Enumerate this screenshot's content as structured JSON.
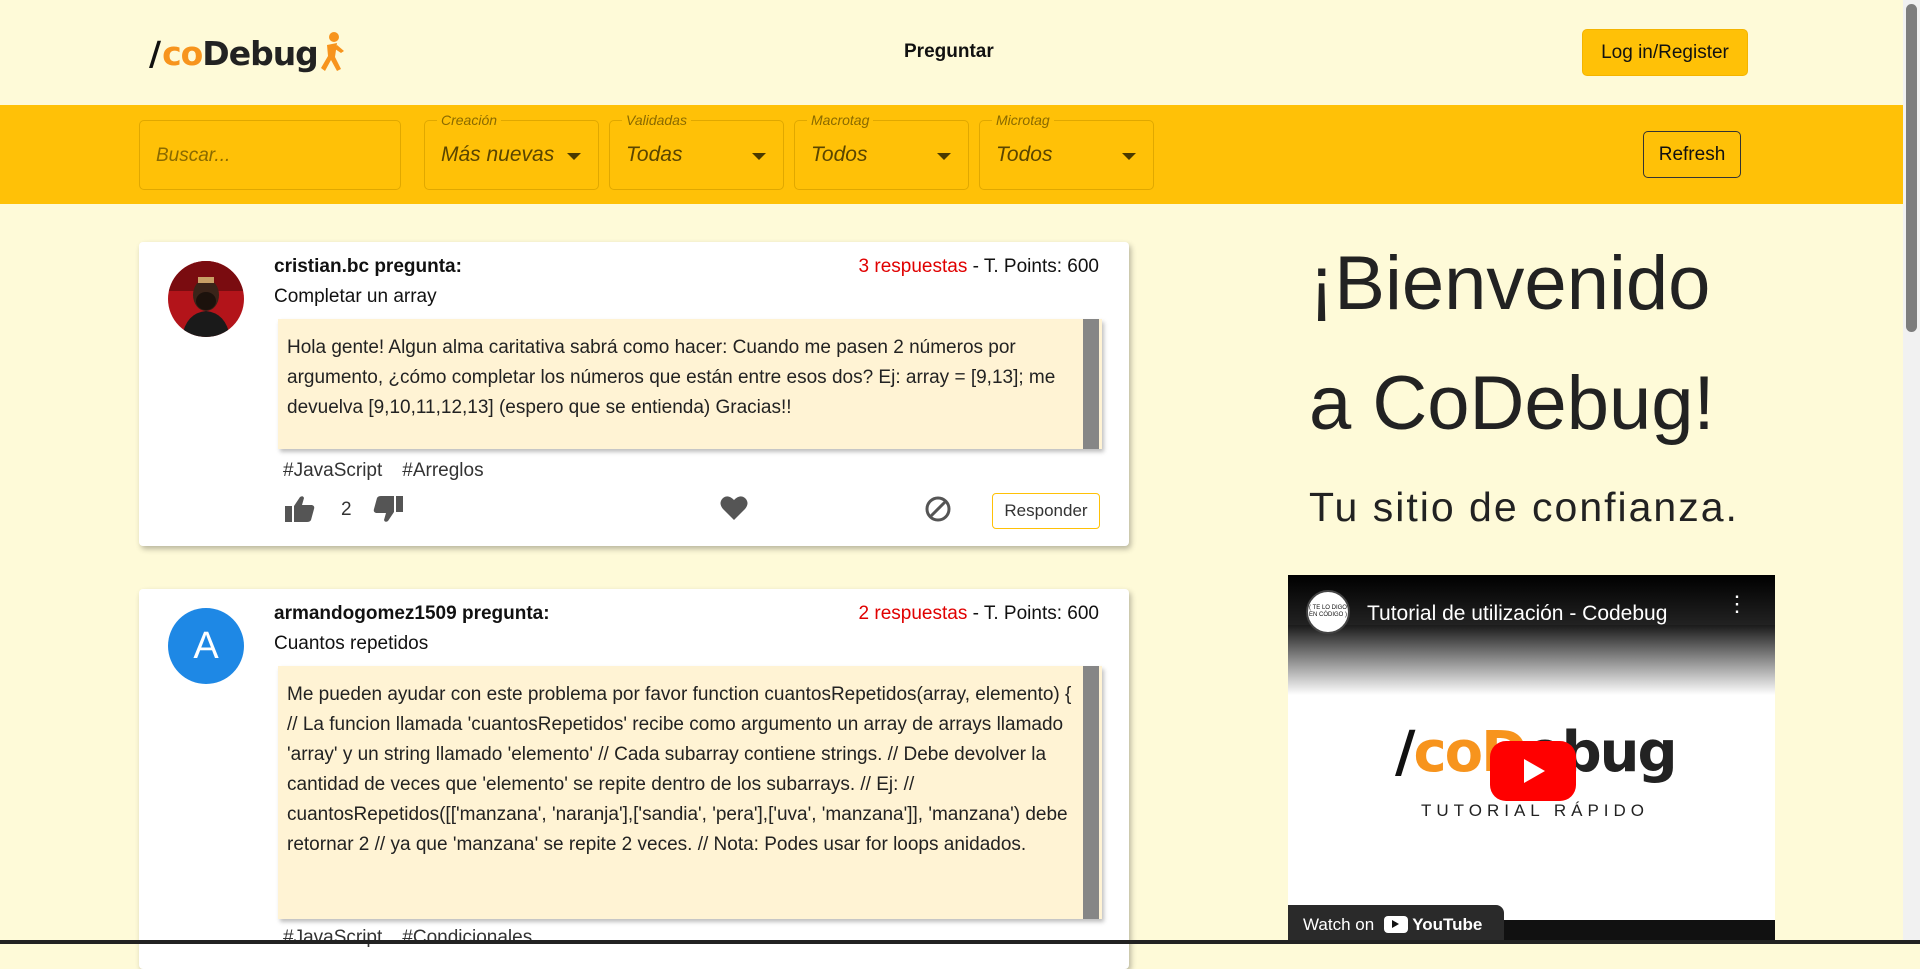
{
  "header": {
    "logo": {
      "slash": "/",
      "co": "co",
      "debug": "Debug"
    },
    "nav_ask": "Preguntar",
    "login_label": "Log in/Register"
  },
  "filters": {
    "search_placeholder": "Buscar...",
    "selects": [
      {
        "label": "Creación",
        "value": "Más nuevas"
      },
      {
        "label": "Validadas",
        "value": "Todas"
      },
      {
        "label": "Macrotag",
        "value": "Todos"
      },
      {
        "label": "Microtag",
        "value": "Todos"
      }
    ],
    "refresh_label": "Refresh"
  },
  "questions": [
    {
      "author": "cristian.bc pregunta:",
      "title": "Completar un array",
      "answers": "3 respuestas",
      "points": " - T. Points: 600",
      "body": "Hola gente! Algun alma caritativa sabrá como hacer: Cuando me pasen 2 números por argumento, ¿cómo completar los números que están entre esos dos? Ej: array = [9,13]; me devuelva [9,10,11,12,13] (espero que se entienda) Gracias!!",
      "tags": [
        "#JavaScript",
        "#Arreglos"
      ],
      "likes": "2",
      "respond_label": "Responder"
    },
    {
      "author": "armandogomez1509 pregunta:",
      "title": "Cuantos repetidos",
      "answers": "2 respuestas",
      "points": " - T. Points: 600",
      "avatar_letter": "A",
      "body": "Me pueden ayudar con este problema por favor function cuantosRepetidos(array, elemento) { // La funcion llamada 'cuantosRepetidos' recibe como argumento un array de arrays llamado 'array' y un string llamado 'elemento' // Cada subarray contiene strings. // Debe devolver la cantidad de veces que 'elemento' se repite dentro de los subarrays. // Ej: // cuantosRepetidos([['manzana', 'naranja'],['sandia', 'pera'],['uva', 'manzana']], 'manzana') debe retornar 2 // ya que 'manzana' se repite 2 veces. // Nota: Podes usar for loops anidados.",
      "tags": [
        "#JavaScript",
        "#Condicionales"
      ]
    }
  ],
  "welcome": {
    "line1": "¡Bienvenido",
    "line2": "a CoDebug!",
    "tagline": "Tu sitio de confianza."
  },
  "video": {
    "channel_badge": "( TE LO DIGO EN CÓDIGO )",
    "title": "Tutorial de utilización - Codebug",
    "logo_slash": "/",
    "logo_co": "coD",
    "logo_debug": "ebug",
    "subtitle": "TUTORIAL RÁPIDO",
    "watch_on": "Watch on",
    "youtube": "YouTube"
  },
  "colors": {
    "accent": "#ffc107",
    "page_bg": "#fefad8",
    "brand_orange": "#f7941d",
    "answers_red": "#e00000"
  }
}
